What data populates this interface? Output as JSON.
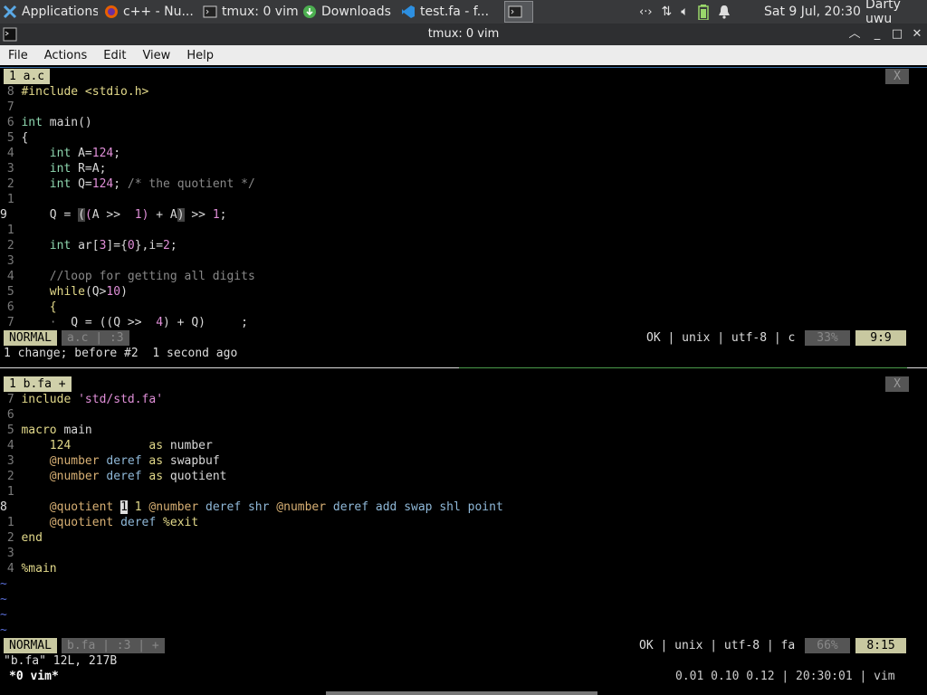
{
  "panel": {
    "tasks": [
      {
        "label": "Applications ☰",
        "icon": "xfce-icon"
      },
      {
        "label": "c++ - Nu...",
        "icon": "firefox-icon"
      },
      {
        "label": "tmux: 0 vim",
        "icon": "terminal-icon"
      },
      {
        "label": "Downloads",
        "icon": "download-icon"
      },
      {
        "label": "test.fa - f...",
        "icon": "vscode-icon"
      },
      {
        "label": "",
        "icon": "terminal-icon"
      }
    ],
    "clock": "Sat  9 Jul, 20:30",
    "user": "Darty uwu"
  },
  "window": {
    "title": "tmux: 0 vim"
  },
  "menu": [
    "File",
    "Actions",
    "Edit",
    "View",
    "Help"
  ],
  "top_pane": {
    "tab": "1 a.c",
    "close": "X",
    "lines": [
      {
        "n": "8",
        "code": "#include <stdio.h>"
      },
      {
        "n": "7",
        "code": ""
      },
      {
        "n": "6",
        "code": "int main()"
      },
      {
        "n": "5",
        "code": "{"
      },
      {
        "n": "4",
        "code": "    int A=124;"
      },
      {
        "n": "3",
        "code": "    int R=A;"
      },
      {
        "n": "2",
        "code": "    int Q=124; /* the quotient */"
      },
      {
        "n": "1",
        "code": ""
      },
      {
        "n": "9",
        "code": "    Q = ((A >>  1) + A) >> 1;"
      },
      {
        "n": "1",
        "code": ""
      },
      {
        "n": "2",
        "code": "    int ar[3]={0},i=2;"
      },
      {
        "n": "3",
        "code": ""
      },
      {
        "n": "4",
        "code": "    //loop for getting all digits"
      },
      {
        "n": "5",
        "code": "    while(Q>10)"
      },
      {
        "n": "6",
        "code": "    {"
      },
      {
        "n": "7",
        "code": "       Q = ((Q >>  4) + Q)     ;"
      }
    ],
    "status": {
      "mode": "NORMAL",
      "file": "a.c | :3",
      "right": "OK | unix | utf-8 | c",
      "pct": "33%",
      "pos": "9:9"
    },
    "message": "1 change; before #2  1 second ago"
  },
  "bottom_pane": {
    "tab": "1 b.fa +",
    "close": "X",
    "lines": [
      {
        "n": "7",
        "code": "include 'std/std.fa'"
      },
      {
        "n": "6",
        "code": ""
      },
      {
        "n": "5",
        "code": "macro main"
      },
      {
        "n": "4",
        "code": "    124           as number"
      },
      {
        "n": "3",
        "code": "    @number deref as swapbuf"
      },
      {
        "n": "2",
        "code": "    @number deref as quotient"
      },
      {
        "n": "1",
        "code": ""
      },
      {
        "n": "8",
        "code": "    @quotient 1 1 @number deref shr @number deref add swap shl point"
      },
      {
        "n": "1",
        "code": "    @quotient deref %exit"
      },
      {
        "n": "2",
        "code": "end"
      },
      {
        "n": "3",
        "code": ""
      },
      {
        "n": "4",
        "code": "%main"
      }
    ],
    "tildes": [
      "~",
      "~",
      "~",
      "~"
    ],
    "status": {
      "mode": "NORMAL",
      "file": "b.fa | :3 | +",
      "right": "OK | unix | utf-8 | fa",
      "pct": "66%",
      "pos": "8:15"
    },
    "message": "\"b.fa\" 12L, 217B"
  },
  "tmux": {
    "window": "*0 vim*",
    "right": "0.01 0.10 0.12 | 20:30:01 | vim"
  }
}
